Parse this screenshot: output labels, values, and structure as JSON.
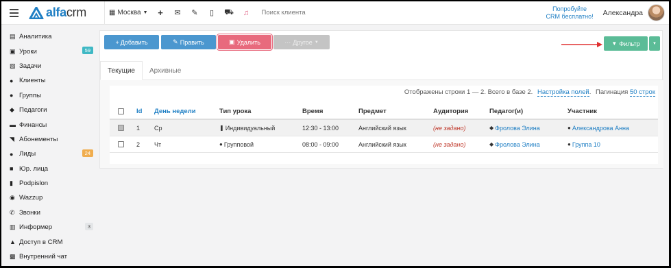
{
  "header": {
    "logo_main": "alfa",
    "logo_suffix": "crm",
    "branch": "Москва",
    "search_placeholder": "Поиск клиента",
    "promo_line1": "Попробуйте",
    "promo_line2": "CRM бесплатно!",
    "user_name": "Александра"
  },
  "sidebar": {
    "items": [
      {
        "label": "Аналитика",
        "icon": "map-icon"
      },
      {
        "label": "Уроки",
        "icon": "calendar-icon",
        "badge": "59"
      },
      {
        "label": "Задачи",
        "icon": "clipboard-icon"
      },
      {
        "label": "Клиенты",
        "icon": "user-icon"
      },
      {
        "label": "Группы",
        "icon": "users-icon"
      },
      {
        "label": "Педагоги",
        "icon": "graduation-cap-icon"
      },
      {
        "label": "Финансы",
        "icon": "money-icon"
      },
      {
        "label": "Абонементы",
        "icon": "tag-icon"
      },
      {
        "label": "Лиды",
        "icon": "user-plus-icon",
        "badge": "24"
      },
      {
        "label": "Юр. лица",
        "icon": "briefcase-icon"
      },
      {
        "label": "Podpislon",
        "icon": "file-icon"
      },
      {
        "label": "Wazzup",
        "icon": "whatsapp-icon"
      },
      {
        "label": "Звонки",
        "icon": "phone-icon"
      },
      {
        "label": "Информер",
        "icon": "book-icon",
        "badge": "3"
      },
      {
        "label": "Доступ в CRM",
        "icon": "lock-icon"
      },
      {
        "label": "Внутренний чат",
        "icon": "chat-icon"
      }
    ]
  },
  "toolbar": {
    "add_label": "Добавить",
    "edit_label": "Править",
    "delete_label": "Удалить",
    "other_label": "Другое",
    "filter_label": "Фильтр"
  },
  "tabs": {
    "current": "Текущие",
    "archive": "Архивные"
  },
  "table_info": {
    "shown": "Отображены строки 1 — 2. Всего в базе 2.",
    "settings_link": "Настройка полей",
    "pagination_label": "Пагинация",
    "pagination_value": "50 строк"
  },
  "columns": {
    "id": "Id",
    "weekday": "День недели",
    "type": "Тип урока",
    "time": "Время",
    "subject": "Предмет",
    "room": "Аудитория",
    "teacher": "Педагог(и)",
    "participant": "Участник"
  },
  "rows": [
    {
      "checked": true,
      "id": "1",
      "weekday": "Ср",
      "type": "Индивидуальный",
      "time": "12:30 - 13:00",
      "subject": "Английский язык",
      "room": "(не задано)",
      "teacher": "Фролова Элина",
      "participant": "Александрова Анна"
    },
    {
      "checked": false,
      "id": "2",
      "weekday": "Чт",
      "type": "Групповой",
      "time": "08:00 - 09:00",
      "subject": "Английский язык",
      "room": "(не задано)",
      "teacher": "Фролова Элина",
      "participant": "Группа 10"
    }
  ],
  "colors": {
    "accent": "#1f7fc4",
    "add": "#4b97cf",
    "delete": "#e86a7d",
    "filter": "#5bbc97",
    "annotation_arrow": "#e03030"
  }
}
